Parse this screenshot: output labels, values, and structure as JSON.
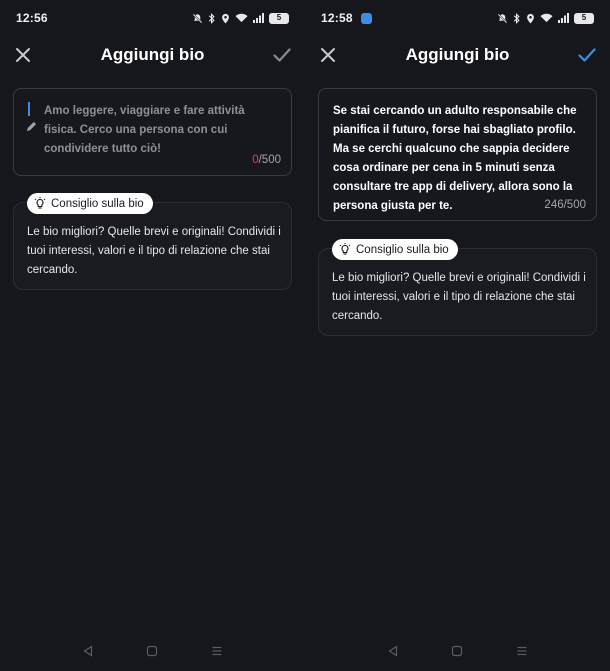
{
  "screens": [
    {
      "status": {
        "time": "12:56",
        "battery": "5"
      },
      "appbar": {
        "title": "Aggiungi bio",
        "check_state": "inactive"
      },
      "bio": {
        "placeholder": "Amo leggere, viaggiare e fare attività fisica. Cerco una persona con cui condividere tutto ciò!",
        "value": "",
        "count": "0",
        "max": "/500"
      },
      "tip": {
        "badge_label": "Consiglio sulla bio",
        "text": "Le bio migliori? Quelle brevi e originali! Condividi i tuoi interessi, valori e il tipo di relazione che stai cercando."
      }
    },
    {
      "status": {
        "time": "12:58",
        "battery": "5"
      },
      "appbar": {
        "title": "Aggiungi bio",
        "check_state": "active"
      },
      "bio": {
        "placeholder": "",
        "value": "Se stai cercando un adulto responsabile che pianifica il futuro, forse hai sbagliato profilo. Ma se cerchi qualcuno che sappia decidere cosa ordinare per cena in 5 minuti senza consultare tre app di delivery, allora sono la persona giusta per te.",
        "count": "246",
        "max": "/500"
      },
      "tip": {
        "badge_label": "Consiglio sulla bio",
        "text": "Le bio migliori? Quelle brevi e originali! Condividi i tuoi interessi, valori e il tipo di relazione che stai cercando."
      }
    }
  ],
  "colors": {
    "background": "#16171c",
    "accent": "#3b8ee8",
    "counter_zero": "#e0483f",
    "check_inactive": "#8a8b92"
  },
  "icons": {
    "close": "close-icon",
    "check": "check-icon",
    "pencil": "pencil-icon",
    "lightbulb": "lightbulb-icon",
    "nav_back": "back-triangle-icon",
    "nav_home": "home-square-icon",
    "nav_recents": "recents-lines-icon"
  }
}
